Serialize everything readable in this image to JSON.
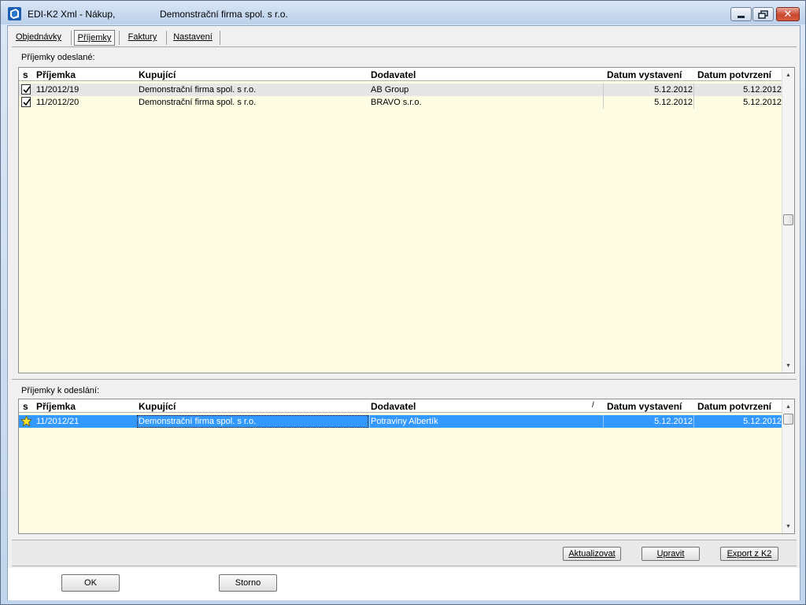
{
  "window": {
    "title": "EDI-K2 Xml - Nákup,",
    "company": "Demonstrační firma spol. s r.o."
  },
  "tabs": [
    {
      "label": "Objednávky",
      "active": false
    },
    {
      "label": "Příjemky",
      "active": true
    },
    {
      "label": "Faktury",
      "active": false
    },
    {
      "label": "Nastavení",
      "active": false
    }
  ],
  "sent_panel": {
    "title": "Příjemky odeslané:",
    "columns": [
      "s",
      "Příjemka",
      "Kupující",
      "Dodavatel",
      "Datum vystavení",
      "Datum potvrzení"
    ],
    "rows": [
      {
        "status_icon": "checkbox-checked-icon",
        "prijemka": "11/2012/19",
        "kupujici": "Demonstrační firma spol. s r.o.",
        "dodavatel": "AB Group",
        "datum_vystaveni": "5.12.2012",
        "datum_potvrzeni": "5.12.2012"
      },
      {
        "status_icon": "checkbox-checked-icon",
        "prijemka": "11/2012/20",
        "kupujici": "Demonstrační firma spol. s r.o.",
        "dodavatel": "BRAVO s.r.o.",
        "datum_vystaveni": "5.12.2012",
        "datum_potvrzeni": "5.12.2012"
      }
    ]
  },
  "pending_panel": {
    "title": "Příjemky k odeslání:",
    "columns": [
      "s",
      "Příjemka",
      "Kupující",
      "Dodavatel",
      "Datum vystavení",
      "Datum potvrzení"
    ],
    "sort_indicator": "/",
    "rows": [
      {
        "status_icon": "star-icon",
        "prijemka": "11/2012/21",
        "kupujici": "Demonstrační firma spol. s r.o.",
        "dodavatel": "Potraviny Albertík",
        "datum_vystaveni": "5.12.2012",
        "datum_potvrzeni": "5.12.2012"
      }
    ]
  },
  "actions": {
    "aktualizovat": "Aktualizovat",
    "upravit": "Upravit",
    "export": "Export z K2"
  },
  "dialog": {
    "ok": "OK",
    "storno": "Storno"
  },
  "colors": {
    "grid_background": "#fefde4",
    "selection": "#3399ff"
  }
}
